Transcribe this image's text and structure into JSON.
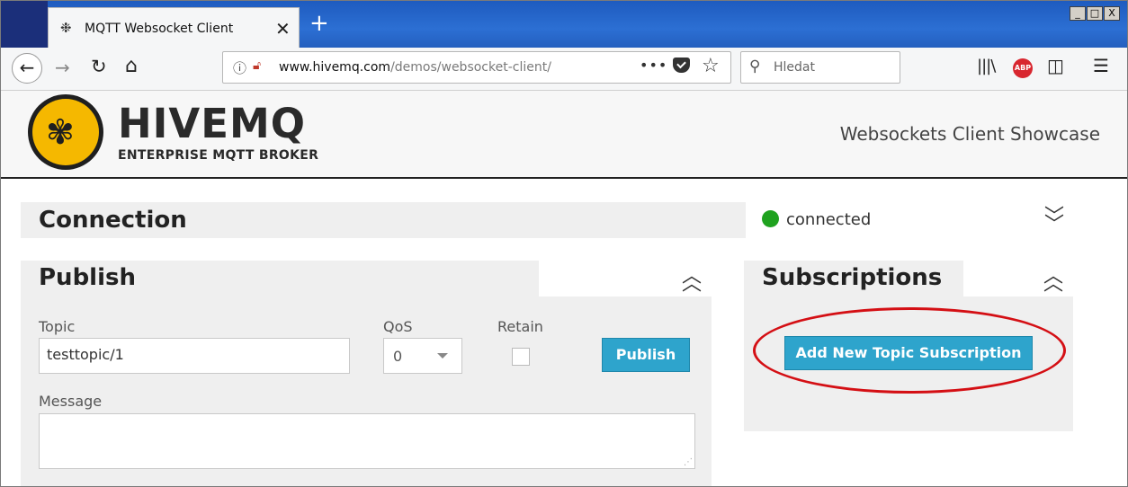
{
  "browser": {
    "tab_title": "MQTT Websocket Client",
    "url_domain": "www.hivemq.com",
    "url_path": "/demos/websocket-client/",
    "search_placeholder": "Hledat",
    "window_buttons": [
      "_",
      "□",
      "X"
    ],
    "abp_label": "ABP"
  },
  "header": {
    "brand": "HIVEMQ",
    "tagline": "ENTERPRISE MQTT BROKER",
    "showcase": "Websockets Client Showcase"
  },
  "connection": {
    "title": "Connection",
    "status": "connected",
    "status_color": "#1fa21f"
  },
  "publish": {
    "title": "Publish",
    "topic_label": "Topic",
    "topic_value": "testtopic/1",
    "qos_label": "QoS",
    "qos_value": "0",
    "retain_label": "Retain",
    "retain_checked": false,
    "button": "Publish",
    "message_label": "Message",
    "message_value": ""
  },
  "subscriptions": {
    "title": "Subscriptions",
    "add_button": "Add New Topic Subscription"
  },
  "colors": {
    "accent": "#2ea4cc",
    "highlight": "#d40f14",
    "brand_yellow": "#f5b800"
  }
}
